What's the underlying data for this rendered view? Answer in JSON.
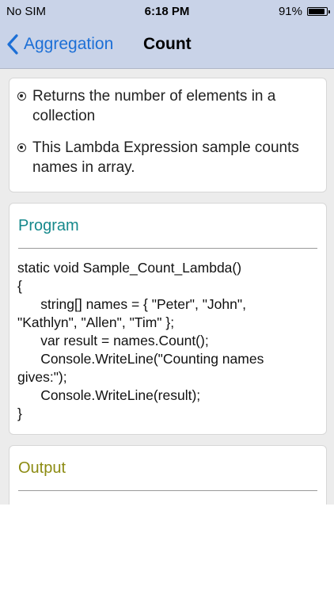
{
  "status_bar": {
    "carrier": "No SIM",
    "time": "6:18 PM",
    "battery_text": "91%",
    "battery_level": 0.91
  },
  "nav": {
    "back_label": "Aggregation",
    "title": "Count"
  },
  "intro": {
    "bullets": [
      "Returns the number of elements in a collection",
      "This Lambda Expression sample counts names in array."
    ]
  },
  "program": {
    "title": "Program",
    "code_lines": [
      "static void Sample_Count_Lambda()",
      "{",
      "      string[] names = { \"Peter\", \"John\",",
      "\"Kathlyn\", \"Allen\", \"Tim\" };",
      "      var result = names.Count();",
      "      Console.WriteLine(\"Counting names",
      "gives:\");",
      "      Console.WriteLine(result);",
      "}"
    ]
  },
  "output": {
    "title": "Output"
  },
  "colors": {
    "nav_bg": "#c9d3e8",
    "accent_blue": "#1c6fd6",
    "program_title": "#16898c",
    "output_title": "#8c8b12",
    "content_bg": "#ececec"
  }
}
